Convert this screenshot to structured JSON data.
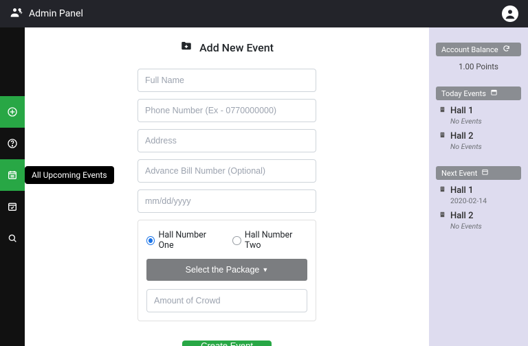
{
  "topbar": {
    "title": "Admin Panel"
  },
  "sidebar": {
    "tooltip": "All Upcoming Events"
  },
  "main": {
    "title": "Add New Event",
    "fields": {
      "full_name_ph": "Full Name",
      "phone_ph": "Phone Number (Ex - 0770000000)",
      "address_ph": "Address",
      "advance_bill_ph": "Advance Bill Number (Optional)",
      "date_ph": "mm/dd/yyyy",
      "crowd_ph": "Amount of Crowd"
    },
    "halls": {
      "opt1": "Hall Number One",
      "opt2": "Hall Number Two"
    },
    "package_btn": "Select the Package",
    "create_btn": "Create Event"
  },
  "right": {
    "balance_label": "Account Balance",
    "balance_points": "1.00 Points",
    "today_label": "Today Events",
    "today": [
      {
        "name": "Hall 1",
        "sub": "No Events"
      },
      {
        "name": "Hall 2",
        "sub": "No Events"
      }
    ],
    "next_label": "Next Event",
    "next": [
      {
        "name": "Hall 1",
        "sub": "2020-02-14"
      },
      {
        "name": "Hall 2",
        "sub": "No Events"
      }
    ]
  },
  "icons": {
    "folder_add": "folder-add-icon",
    "sync": "sync-icon",
    "calendar_day": "calendar-day-icon",
    "calendar": "calendar-icon",
    "building": "building-icon"
  }
}
